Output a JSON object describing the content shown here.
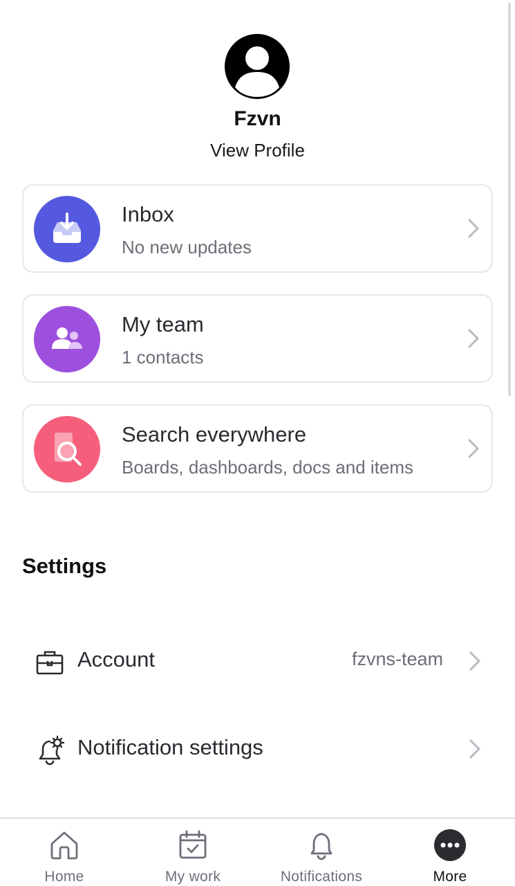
{
  "profile": {
    "name": "Fzvn",
    "view_profile_label": "View Profile"
  },
  "cards": [
    {
      "title": "Inbox",
      "subtitle": "No new updates",
      "icon": "inbox-download-icon",
      "color": "#5559df"
    },
    {
      "title": "My team",
      "subtitle": "1 contacts",
      "icon": "team-people-icon",
      "color": "#9d50dd"
    },
    {
      "title": "Search everywhere",
      "subtitle": "Boards, dashboards, docs and items",
      "icon": "search-document-icon",
      "color": "#f65f7c"
    }
  ],
  "settings": {
    "title": "Settings",
    "items": [
      {
        "label": "Account",
        "value": "fzvns-team",
        "icon": "briefcase-icon"
      },
      {
        "label": "Notification settings",
        "value": "",
        "icon": "bell-gear-icon"
      }
    ]
  },
  "tabbar": {
    "items": [
      {
        "label": "Home",
        "icon": "home-icon",
        "active": false
      },
      {
        "label": "My work",
        "icon": "calendar-check-icon",
        "active": false
      },
      {
        "label": "Notifications",
        "icon": "bell-icon",
        "active": false
      },
      {
        "label": "More",
        "icon": "more-dots-icon",
        "active": true
      }
    ]
  }
}
